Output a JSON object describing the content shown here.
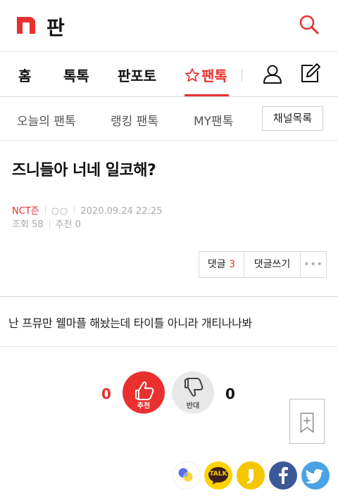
{
  "header": {
    "logo_text": "판",
    "search_label": "검색"
  },
  "nav": {
    "home": "홈",
    "toktok": "톡톡",
    "pantotok": "판포토",
    "pantok": "팬톡"
  },
  "subnav": {
    "today": "오늘의 팬톡",
    "ranking": "랭킹 팬톡",
    "my": "MY팬톡",
    "channel_list": "채널목록"
  },
  "post": {
    "title": "즈니들아 너네 일코해?",
    "author": "NCT즌",
    "author_dots": "○○",
    "date": "2020.09.24 22:25",
    "views_label": "조회",
    "views": "58",
    "recommend_label": "추천",
    "recommend": "0",
    "body": "난 프뮤만 웰마플 해놨는데 타이틀 아니라 개티나나봐"
  },
  "comments": {
    "label": "댓글",
    "count": "3",
    "write_label": "댓글쓰기",
    "more": "•••"
  },
  "votes": {
    "up_count": "0",
    "up_label": "추천",
    "down_label": "반대",
    "down_count": "0"
  },
  "share": {
    "kakaotalk_text": "TALK"
  },
  "colors": {
    "accent": "#e9302f",
    "facebook": "#3b5998",
    "twitter": "#4ba2e3",
    "kakao": "#fcd200"
  }
}
